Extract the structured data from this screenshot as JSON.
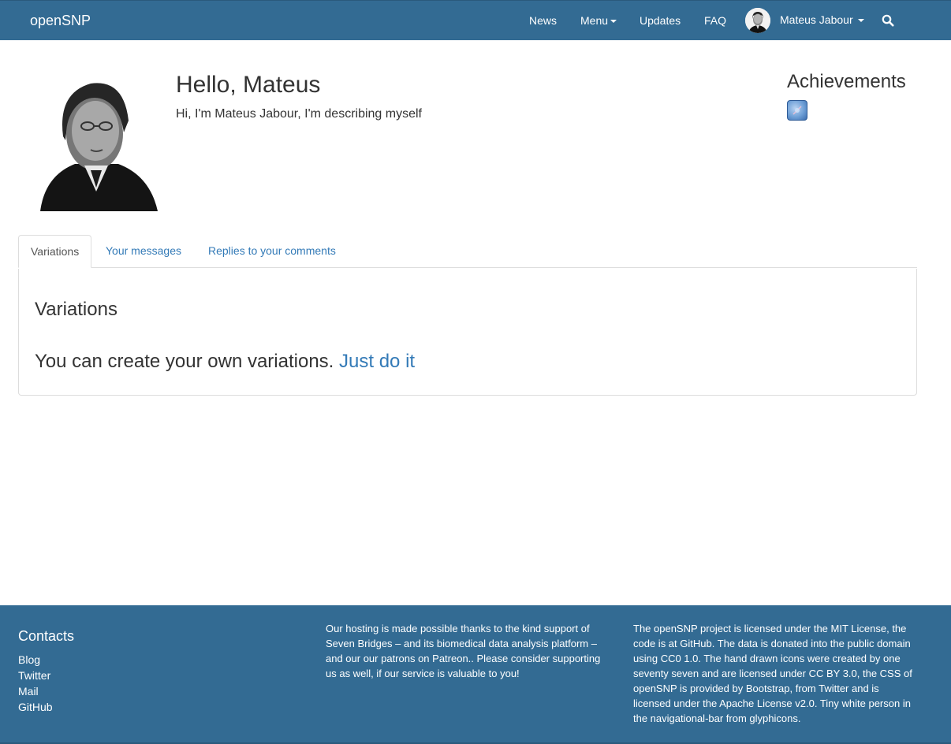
{
  "navbar": {
    "brand": "openSNP",
    "news": "News",
    "menu": "Menu",
    "updates": "Updates",
    "faq": "FAQ",
    "user_name": "Mateus Jabour",
    "search_icon": "search-icon",
    "background": "#336b93"
  },
  "profile": {
    "greeting": "Hello, Mateus",
    "bio": "Hi, I'm Mateus Jabour, I'm describing myself"
  },
  "achievements": {
    "title": "Achievements",
    "badge_icon": "achievement-badge-icon"
  },
  "tabs": [
    {
      "label": "Variations",
      "active": true
    },
    {
      "label": "Your messages",
      "active": false
    },
    {
      "label": "Replies to your comments",
      "active": false
    }
  ],
  "panel": {
    "title": "Variations",
    "text": "You can create your own variations.",
    "link": "Just do it"
  },
  "footer": {
    "contacts_title": "Contacts",
    "links": [
      "Blog",
      "Twitter",
      "Mail",
      "GitHub"
    ],
    "hosting_text": "Our hosting is made possible thanks to the kind support of Seven Bridges – and its biomedical data analysis platform – and our our patrons on Patreon.. Please consider supporting us as well, if our service is valuable to you!",
    "license_text": "The openSNP project is licensed under the MIT License, the code is at GitHub. The data is donated into the public domain using CC0 1.0. The hand drawn icons were created by one seventy seven and are licensed under CC BY 3.0, the CSS of openSNP is provided by Bootstrap, from Twitter and is licensed under the Apache License v2.0. Tiny white person in the navigational-bar from glyphicons."
  }
}
